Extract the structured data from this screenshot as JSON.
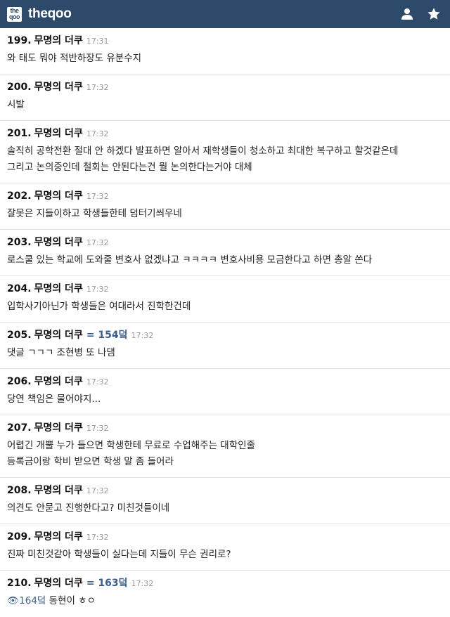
{
  "header": {
    "logo_top": "the",
    "logo_bottom": "qoo",
    "brand": "theqoo",
    "icons": [
      "user-icon",
      "star-icon"
    ]
  },
  "colors": {
    "topbar": "#2d4a6b",
    "duk": "#3b5f8a"
  },
  "comments": [
    {
      "num": "199.",
      "author": "무명의 더쿠",
      "duk": "",
      "time": "17:31",
      "lines": [
        "와 태도 뭐야 적반하장도 유분수지"
      ]
    },
    {
      "num": "200.",
      "author": "무명의 더쿠",
      "duk": "",
      "time": "17:32",
      "lines": [
        "시발"
      ]
    },
    {
      "num": "201.",
      "author": "무명의 더쿠",
      "duk": "",
      "time": "17:32",
      "lines": [
        "솔직히 공학전환 절대 안 하겠다 발표하면 알아서 재학생들이 청소하고 최대한 복구하고 할것같은데",
        "그리고 논의중인데 철회는 안된다는건 뭘 논의한다는거야 대체"
      ]
    },
    {
      "num": "202.",
      "author": "무명의 더쿠",
      "duk": "",
      "time": "17:32",
      "lines": [
        "잘못은 지들이하고 학생들한테 덤터기씌우네"
      ]
    },
    {
      "num": "203.",
      "author": "무명의 더쿠",
      "duk": "",
      "time": "17:32",
      "lines": [
        "로스쿨 있는 학교에 도와줄 변호사 없겠냐고 ㅋㅋㅋㅋ 변호사비용 모금한다고 하면 총알 쏜다"
      ]
    },
    {
      "num": "204.",
      "author": "무명의 더쿠",
      "duk": "",
      "time": "17:32",
      "lines": [
        "입학사기아닌가 학생들은 여대라서 진학한건데"
      ]
    },
    {
      "num": "205.",
      "author": "무명의 더쿠",
      "duk": "= 154덬",
      "time": "17:32",
      "lines": [
        "댓글 ㄱㄱㄱ 조현병 또 나댐"
      ]
    },
    {
      "num": "206.",
      "author": "무명의 더쿠",
      "duk": "",
      "time": "17:32",
      "lines": [
        "당연 책임은 물어야지..."
      ]
    },
    {
      "num": "207.",
      "author": "무명의 더쿠",
      "duk": "",
      "time": "17:32",
      "lines": [
        "어렵긴 개뿔 누가 들으면 학생한테 무료로 수업해주는 대학인줄",
        "등록금이랑 학비 받으면 학생 말 좀 들어라"
      ]
    },
    {
      "num": "208.",
      "author": "무명의 더쿠",
      "duk": "",
      "time": "17:32",
      "lines": [
        "의견도 안묻고 진행한다고? 미친것들이네"
      ]
    },
    {
      "num": "209.",
      "author": "무명의 더쿠",
      "duk": "",
      "time": "17:32",
      "lines": [
        "진짜 미친것같아 학생들이 싫다는데 지들이 무슨 권리로?"
      ]
    },
    {
      "num": "210.",
      "author": "무명의 더쿠",
      "duk": "= 163덬",
      "time": "17:32",
      "reply_ref": "👁164덬",
      "lines": [
        "동현이 ㅎㅇ"
      ]
    }
  ]
}
